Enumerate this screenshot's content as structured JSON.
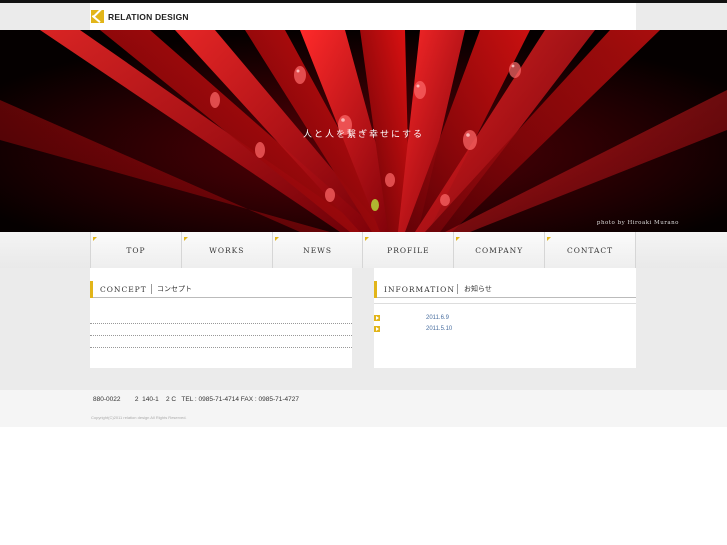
{
  "header": {
    "logo_text": "RELATION DESIGN",
    "brand_color": "#e2b519"
  },
  "hero": {
    "tagline": "人と人を繋ぎ幸せにする",
    "credit": "photo by Hiroaki Murano",
    "image_description_icon": "red-plant-with-water-drops"
  },
  "nav": {
    "items": [
      {
        "label": "TOP"
      },
      {
        "label": "WORKS"
      },
      {
        "label": "NEWS"
      },
      {
        "label": "PROFILE"
      },
      {
        "label": "COMPANY"
      },
      {
        "label": "CONTACT"
      }
    ]
  },
  "concept": {
    "title_en": "CONCEPT",
    "title_jp": "コンセプト"
  },
  "information": {
    "title_en": "INFORMATION",
    "title_jp": "お知らせ",
    "items": [
      {
        "date": "2011.6.9"
      },
      {
        "date": "2011.5.10"
      }
    ]
  },
  "footer": {
    "address": "880-0022        2  140-1    2 C   TEL : 0985-71-4714 FAX : 0985-71-4727",
    "copyright": "Copyright(C)2011 relation design All Rights Reserved."
  }
}
